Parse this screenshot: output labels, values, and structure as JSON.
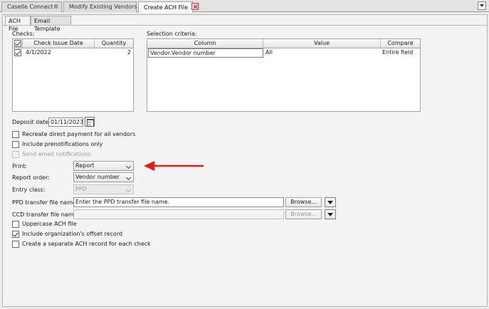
{
  "top_tabs": [
    {
      "label": "Caselle Connect®",
      "active": false
    },
    {
      "label": "Modify Existing Vendors",
      "active": false
    },
    {
      "label": "Create ACH File",
      "active": true
    }
  ],
  "sub_tabs": [
    {
      "label": "ACH File",
      "active": true
    },
    {
      "label": "Email Template",
      "active": false
    }
  ],
  "checks": {
    "label": "Checks:",
    "columns": [
      "Check Issue Date",
      "Quantity"
    ],
    "rows": [
      {
        "checked": true,
        "date": "4/1/2022",
        "quantity": "2"
      }
    ]
  },
  "selection": {
    "label": "Selection criteria:",
    "columns": [
      "Column",
      "Value",
      "Compare"
    ],
    "rows": [
      {
        "column": "Vendor.Vendor number",
        "value": "All",
        "compare": "Entire field"
      }
    ]
  },
  "deposit": {
    "label": "Deposit date:",
    "value": "01/11/2023"
  },
  "options_top": [
    {
      "label": "Recreate direct payment for all vendors",
      "checked": false,
      "disabled": false
    },
    {
      "label": "Include prenotifications only",
      "checked": false,
      "disabled": false
    },
    {
      "label": "Send email notifications",
      "checked": false,
      "disabled": true
    }
  ],
  "print": {
    "label": "Print:",
    "value": "Report"
  },
  "report_order": {
    "label": "Report order:",
    "value": "Vendor number"
  },
  "entry_class": {
    "label": "Entry class:",
    "value": "PPD"
  },
  "ppd": {
    "label": "PPD transfer file name:",
    "value": "Enter the PPD transfer file name.",
    "browse": "Browse..."
  },
  "ccd": {
    "label": "CCD transfer file name:",
    "value": "",
    "browse": "Browse..."
  },
  "options_bottom": [
    {
      "label": "Uppercase ACH file",
      "checked": false
    },
    {
      "label": "Include organization's offset record",
      "checked": true
    },
    {
      "label": "Create a separate ACH record for each check",
      "checked": false
    }
  ],
  "colors": {
    "arrow": "#e51c1c",
    "background": "#f3f3f3"
  }
}
